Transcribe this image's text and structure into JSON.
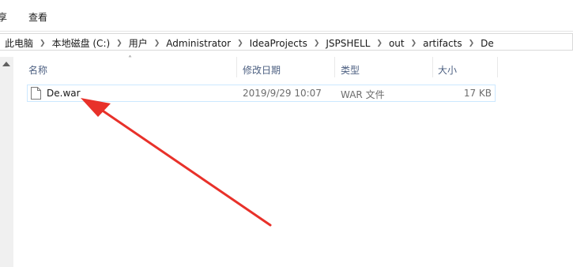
{
  "ribbon": {
    "tabs": [
      "享",
      "查看"
    ]
  },
  "address": {
    "crumbs": [
      "此电脑",
      "本地磁盘 (C:)",
      "用户",
      "Administrator",
      "IdeaProjects",
      "JSPSHELL",
      "out",
      "artifacts",
      "De"
    ]
  },
  "columns": {
    "name": "名称",
    "modified": "修改日期",
    "type": "类型",
    "size": "大小"
  },
  "files": [
    {
      "name": "De.war",
      "modified": "2019/9/29 10:07",
      "type": "WAR 文件",
      "size": "17 KB",
      "icon": "file-icon"
    }
  ],
  "annotation": {
    "color": "#e8312a",
    "icon": "red-arrow-annotation"
  }
}
